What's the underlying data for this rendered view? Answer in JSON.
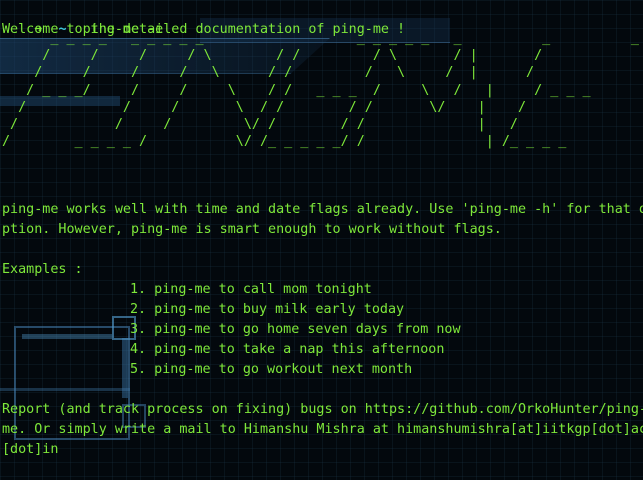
{
  "session": {
    "prompt_arrow": "➜",
    "prompt_dir": "~",
    "command": "ping-me -e"
  },
  "output": {
    "welcome": "Welcome to the detailed documentation of ping-me !",
    "banner_lines": [
      "      _ _ _ _   _ _ _ _ _                   _ _ _ _ _   _          _          _ _ _ _",
      "     /     /     /     / \\        / /         / \\       / |       /",
      "    /     /     /     /   \\      / /         /   \\     /  |      /",
      "   / _ _ _/     /     /     \\    / /   _ _ _  /     \\   /   |     / _ _ _",
      "  /            /     /       \\  / /        / /       \\/    |    /",
      " /            /     /         \\/ /        / /              |   /",
      "/        _ _ _ _ /           \\/ /_ _ _ _ _/ /               | /_ _ _ _"
    ],
    "intro_line1": "ping-me works well with time and date flags already. Use 'ping-me -h' for that o",
    "intro_line2": "ption. However, ping-me is smart enough to work without flags.",
    "examples_heading": "Examples :",
    "examples": [
      "1. ping-me to call mom tonight",
      "2. ping-me to buy milk early today",
      "3. ping-me to go home seven days from now",
      "4. ping-me to take a nap this afternoon",
      "5. ping-me to go workout next month"
    ],
    "report_line1": "Report (and track process on fixing) bugs on https://github.com/OrkoHunter/ping-",
    "report_line2": "me. Or simply write a mail to Himanshu Mishra at himanshumishra[at]iitkgp[dot]ac",
    "report_line3": "[dot]in"
  },
  "next_prompt": {
    "prompt_arrow": "➜",
    "prompt_dir": "~",
    "input_value": ""
  },
  "colors": {
    "text": "#7ee83a",
    "prompt_error_arrow": "#e0392a",
    "prompt_dir": "#3ec6d8",
    "background": "#03080d"
  }
}
